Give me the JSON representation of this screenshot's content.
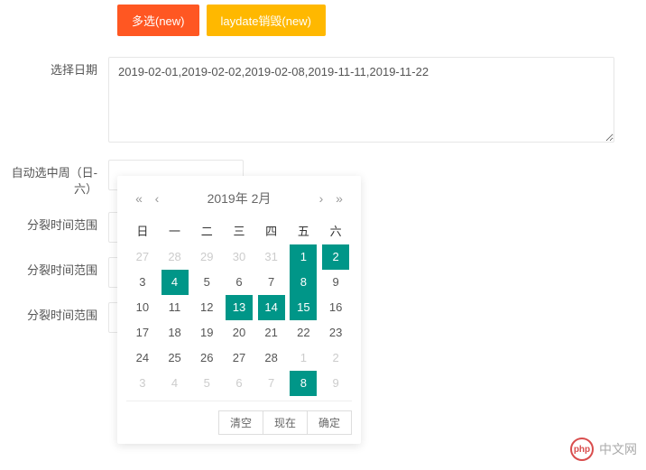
{
  "top": {
    "btn_multi": "多选(new)",
    "btn_destroy": "laydate销毁(new)"
  },
  "form": {
    "label_select_date": "选择日期",
    "textarea_value": "2019-02-01,2019-02-02,2019-02-08,2019-11-11,2019-11-22",
    "label_auto_week": "自动选中周（日-六）",
    "label_split_range_1": "分裂时间范围",
    "label_split_range_2": "分裂时间范围",
    "label_split_range_3": "分裂时间范围"
  },
  "datepicker": {
    "year_month": "2019年 2月",
    "weekdays": [
      "日",
      "一",
      "二",
      "三",
      "四",
      "五",
      "六"
    ],
    "rows": [
      [
        {
          "d": 27,
          "m": "other"
        },
        {
          "d": 28,
          "m": "other"
        },
        {
          "d": 29,
          "m": "other"
        },
        {
          "d": 30,
          "m": "other"
        },
        {
          "d": 31,
          "m": "other"
        },
        {
          "d": 1,
          "m": "selected"
        },
        {
          "d": 2,
          "m": "selected"
        }
      ],
      [
        {
          "d": 3,
          "m": "current"
        },
        {
          "d": 4,
          "m": "selected"
        },
        {
          "d": 5,
          "m": "current"
        },
        {
          "d": 6,
          "m": "current"
        },
        {
          "d": 7,
          "m": "current"
        },
        {
          "d": 8,
          "m": "selected"
        },
        {
          "d": 9,
          "m": "current"
        }
      ],
      [
        {
          "d": 10,
          "m": "current"
        },
        {
          "d": 11,
          "m": "current"
        },
        {
          "d": 12,
          "m": "current"
        },
        {
          "d": 13,
          "m": "selected"
        },
        {
          "d": 14,
          "m": "selected"
        },
        {
          "d": 15,
          "m": "selected"
        },
        {
          "d": 16,
          "m": "current"
        }
      ],
      [
        {
          "d": 17,
          "m": "current"
        },
        {
          "d": 18,
          "m": "current"
        },
        {
          "d": 19,
          "m": "current"
        },
        {
          "d": 20,
          "m": "current"
        },
        {
          "d": 21,
          "m": "current"
        },
        {
          "d": 22,
          "m": "current"
        },
        {
          "d": 23,
          "m": "current"
        }
      ],
      [
        {
          "d": 24,
          "m": "current"
        },
        {
          "d": 25,
          "m": "current"
        },
        {
          "d": 26,
          "m": "current"
        },
        {
          "d": 27,
          "m": "current"
        },
        {
          "d": 28,
          "m": "current"
        },
        {
          "d": 1,
          "m": "other"
        },
        {
          "d": 2,
          "m": "other"
        }
      ],
      [
        {
          "d": 3,
          "m": "other"
        },
        {
          "d": 4,
          "m": "other"
        },
        {
          "d": 5,
          "m": "other"
        },
        {
          "d": 6,
          "m": "other"
        },
        {
          "d": 7,
          "m": "other"
        },
        {
          "d": 8,
          "m": "selected"
        },
        {
          "d": 9,
          "m": "other"
        }
      ]
    ],
    "btn_clear": "清空",
    "btn_now": "现在",
    "btn_confirm": "确定"
  },
  "brand": {
    "logo_text": "php",
    "name": "中文网"
  },
  "colors": {
    "selected": "#009688",
    "orange": "#FF5722",
    "yellow": "#FFB800"
  }
}
